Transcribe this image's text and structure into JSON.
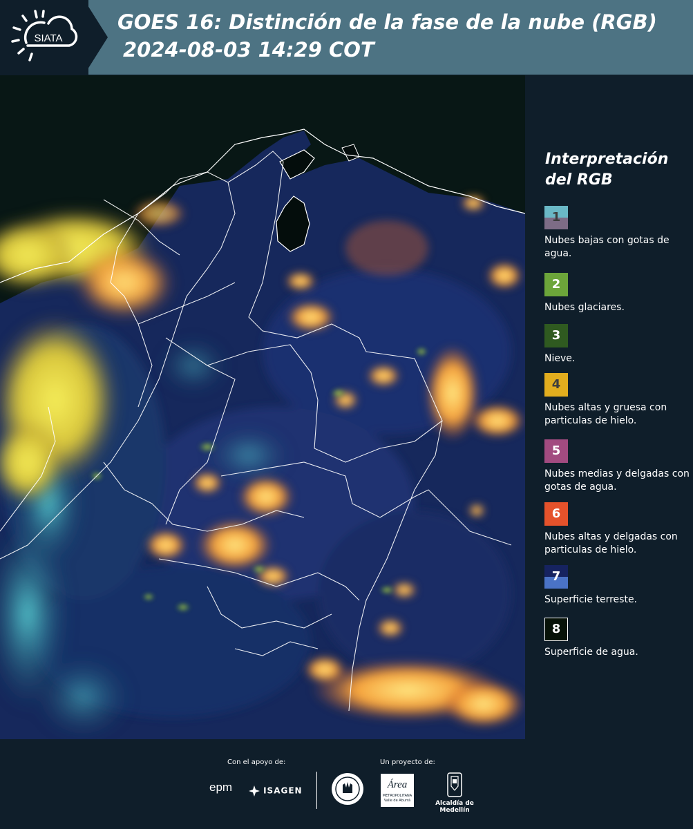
{
  "header": {
    "logo_text": "SIATA",
    "title": "GOES 16: Distinción de la fase de la nube (RGB)",
    "datetime": "2024-08-03 14:29 COT"
  },
  "legend": {
    "title": "Interpretación del RGB",
    "items": [
      {
        "number": "1",
        "label": "Nubes bajas con gotas de agua.",
        "color_top": "#6ab8c6",
        "color_bottom": "#7d6c86"
      },
      {
        "number": "2",
        "label": "Nubes glaciares.",
        "color_top": "#6ca53a",
        "color_bottom": "#6ca53a"
      },
      {
        "number": "3",
        "label": "Nieve.",
        "color_top": "#2f5a20",
        "color_bottom": "#2f5a20"
      },
      {
        "number": "4",
        "label": "Nubes altas y gruesa con particulas de hielo.",
        "color_top": "#e2ad1e",
        "color_bottom": "#e2ad1e"
      },
      {
        "number": "5",
        "label": "Nubes medias y delgadas con gotas de agua.",
        "color_top": "#a24b80",
        "color_bottom": "#a24b80"
      },
      {
        "number": "6",
        "label": "Nubes altas y delgadas con particulas de hielo.",
        "color_top": "#e5522b",
        "color_bottom": "#e5522b"
      },
      {
        "number": "7",
        "label": "Superficie terreste.",
        "color_top": "#162360",
        "color_bottom": "#4a73c6"
      },
      {
        "number": "8",
        "label": "Superficie de agua.",
        "color_top": "#071208",
        "color_bottom": "#071208"
      }
    ]
  },
  "footer": {
    "support_label": "Con el apoyo de:",
    "project_label": "Un proyecto de:",
    "sponsor_epm": "epm",
    "sponsor_isagen": "ISAGEN",
    "area_logo_text": "Área",
    "area_subtitle": "METROPOLITANA",
    "area_subtitle2": "Valle de Aburrá",
    "alcaldia": "Alcaldía de Medellín"
  },
  "colors": {
    "background": "#0f1e2a",
    "header_band": "#4d7383",
    "cloud_orange": "#f09a3a",
    "cloud_yellow": "#f2e24a",
    "land_blue": "#1b2c66",
    "low_cloud_cyan": "#4fb8c4",
    "border_white": "#ffffff"
  }
}
